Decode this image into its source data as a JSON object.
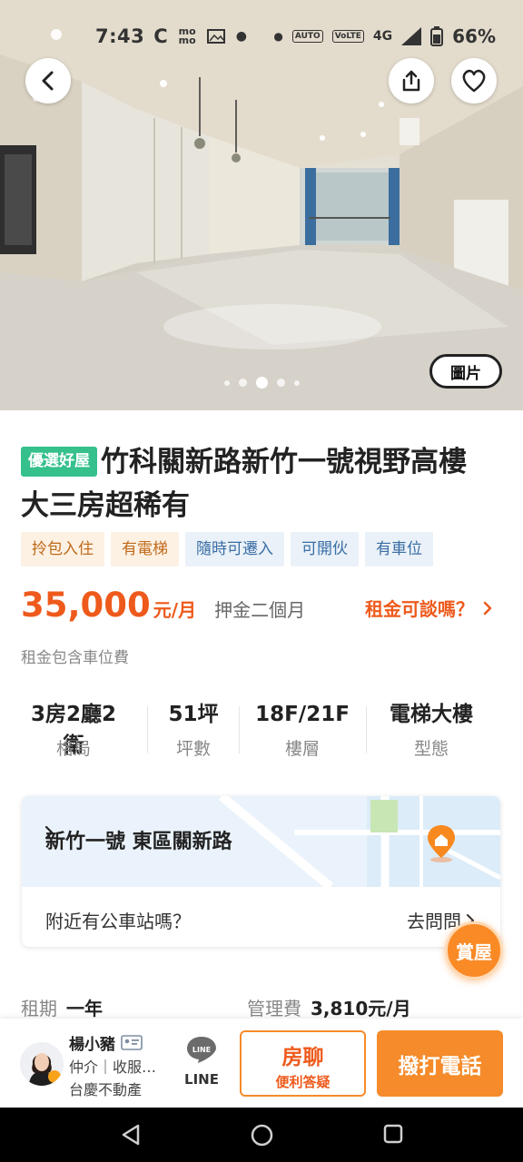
{
  "status_bar": {
    "time": "7:43",
    "icons": [
      "c-icon",
      "momo-icon",
      "image-icon",
      "dot-icon"
    ],
    "right_icons": [
      "alarm-icon",
      "auto-icon",
      "volte-icon",
      "4g-icon",
      "signal-icon",
      "battery-icon"
    ],
    "network": "4G",
    "battery": "66%"
  },
  "hero": {
    "photo_button": "圖片",
    "dots_count": 5,
    "active_dot": 2
  },
  "listing": {
    "badge": "優選好屋",
    "title": "竹科關新路新竹一號視野高樓大三房超稀有",
    "tags": [
      {
        "label": "拎包入住",
        "style": "warm"
      },
      {
        "label": "有電梯",
        "style": "warm"
      },
      {
        "label": "隨時可遷入",
        "style": "cool"
      },
      {
        "label": "可開伙",
        "style": "cool"
      },
      {
        "label": "有車位",
        "style": "cool"
      }
    ],
    "price": "35,000",
    "price_unit": "元/月",
    "deposit": "押金二個月",
    "negotiate": "租金可談嗎？",
    "note": "租金包含車位費",
    "specs": [
      {
        "value": "3房2廳2衛",
        "label": "格局"
      },
      {
        "value": "51坪",
        "label": "坪數"
      },
      {
        "value": "18F/21F",
        "label": "樓層"
      },
      {
        "value": "電梯大樓",
        "label": "型態"
      }
    ]
  },
  "map": {
    "address": "新竹一號 東區關新路",
    "bus_question": "附近有公車站嗎？",
    "ask_link": "去問問"
  },
  "fab": {
    "label": "賞屋"
  },
  "lease": {
    "term_label": "租期",
    "term_value": "一年",
    "mgmt_label": "管理費",
    "mgmt_value": "3,810元/月"
  },
  "agent": {
    "name": "楊小豬",
    "role": "仲介｜收服…",
    "company": "台慶不動產"
  },
  "actions": {
    "line_label": "LINE",
    "chat_title": "房聊",
    "chat_subtitle": "便利答疑",
    "call": "撥打電話"
  },
  "colors": {
    "accent": "#ee5a1c",
    "cta": "#f58b2a",
    "badge_green": "#35c08c"
  }
}
